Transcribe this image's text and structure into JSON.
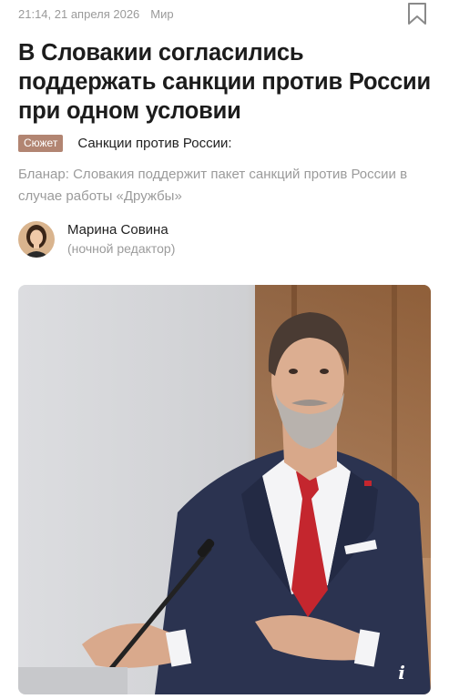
{
  "meta": {
    "time": "21:14, 21 апреля 2026",
    "rubric": "Мир"
  },
  "article": {
    "title": "В Словакии согласились поддержать санкции против России при одном условии",
    "story_badge": "Сюжет",
    "story_title": "Санкции против России:",
    "lead": "Бланар: Словакия поддержит пакет санкций против России в случае работы «Дружбы»"
  },
  "author": {
    "name": "Марина Совина",
    "role": "(ночной редактор)"
  },
  "photo": {
    "info_label": "i"
  },
  "colors": {
    "badge": "#b28572",
    "muted": "#9b9b9b",
    "tie": "#c4262e",
    "suit": "#2b3350"
  },
  "icons": [
    "bookmark-icon",
    "info-icon"
  ]
}
